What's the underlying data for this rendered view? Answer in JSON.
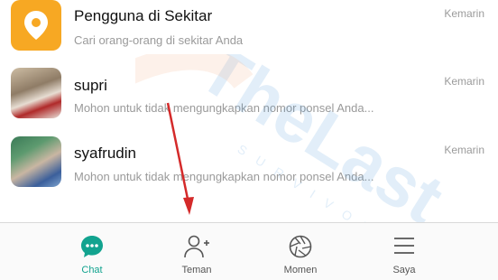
{
  "rows": [
    {
      "name": "Pengguna di Sekitar",
      "subtitle": "Cari orang-orang di sekitar Anda",
      "time": "Kemarin",
      "icon": "location-pin-icon"
    },
    {
      "name": "supri",
      "subtitle": "Mohon untuk tidak  mengungkapkan nomor ponsel Anda...",
      "time": "Kemarin"
    },
    {
      "name": "syafrudin",
      "subtitle": "Mohon untuk tidak  mengungkapkan nomor ponsel Anda...",
      "time": "Kemarin"
    }
  ],
  "tabs": [
    {
      "label": "Chat",
      "icon": "chat-bubble-icon",
      "active": true
    },
    {
      "label": "Teman",
      "icon": "add-friend-icon"
    },
    {
      "label": "Momen",
      "icon": "moments-aperture-icon"
    },
    {
      "label": "Saya",
      "icon": "menu-lines-icon"
    }
  ],
  "watermark": {
    "text": "TheLast",
    "subtext": "SURVIVOR"
  },
  "colors": {
    "accent": "#12a38f",
    "nearby": "#f7a823",
    "arrow": "#d42a2a",
    "watermark": "#3a8fd6"
  }
}
